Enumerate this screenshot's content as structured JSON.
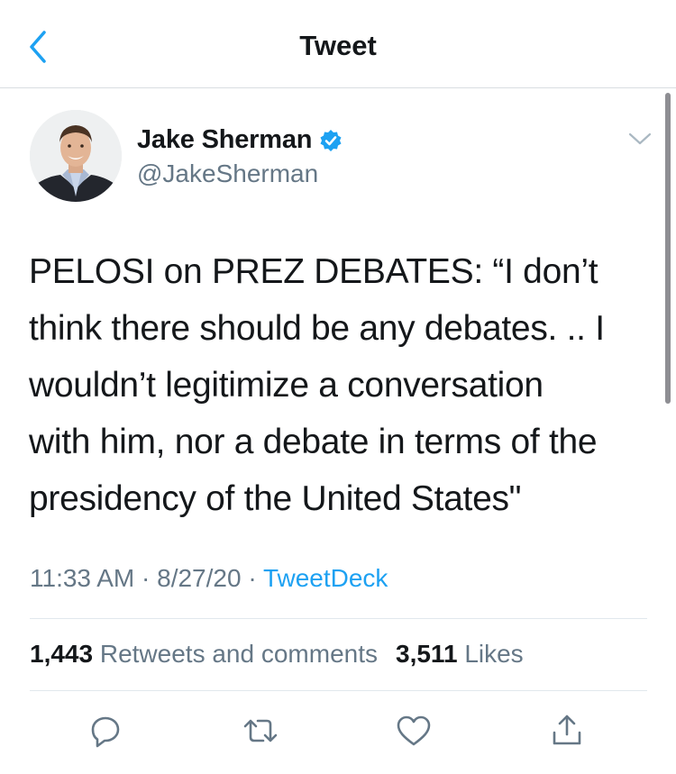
{
  "header": {
    "title": "Tweet",
    "back_icon": "chevron-left-icon"
  },
  "author": {
    "name": "Jake Sherman",
    "handle": "@JakeSherman",
    "verified": true,
    "verified_color": "#1da1f2"
  },
  "tweet": {
    "lines": [
      "PELOSI on PREZ DEBATES: “I don’t",
      "think there should be any debates. .. I",
      "wouldn’t legitimize a conversation",
      "with him, nor a debate in terms of the",
      "presidency of the United States\""
    ]
  },
  "meta": {
    "time": "11:33 AM",
    "separator": "·",
    "date": "8/27/20",
    "source": "TweetDeck"
  },
  "stats": {
    "retweets_count": "1,443",
    "retweets_label": "Retweets and comments",
    "likes_count": "3,511",
    "likes_label": "Likes"
  },
  "actions": [
    "reply-icon",
    "retweet-icon",
    "like-icon",
    "share-icon"
  ],
  "colors": {
    "accent": "#1da1f2",
    "text": "#14171a",
    "secondary": "#657786"
  }
}
